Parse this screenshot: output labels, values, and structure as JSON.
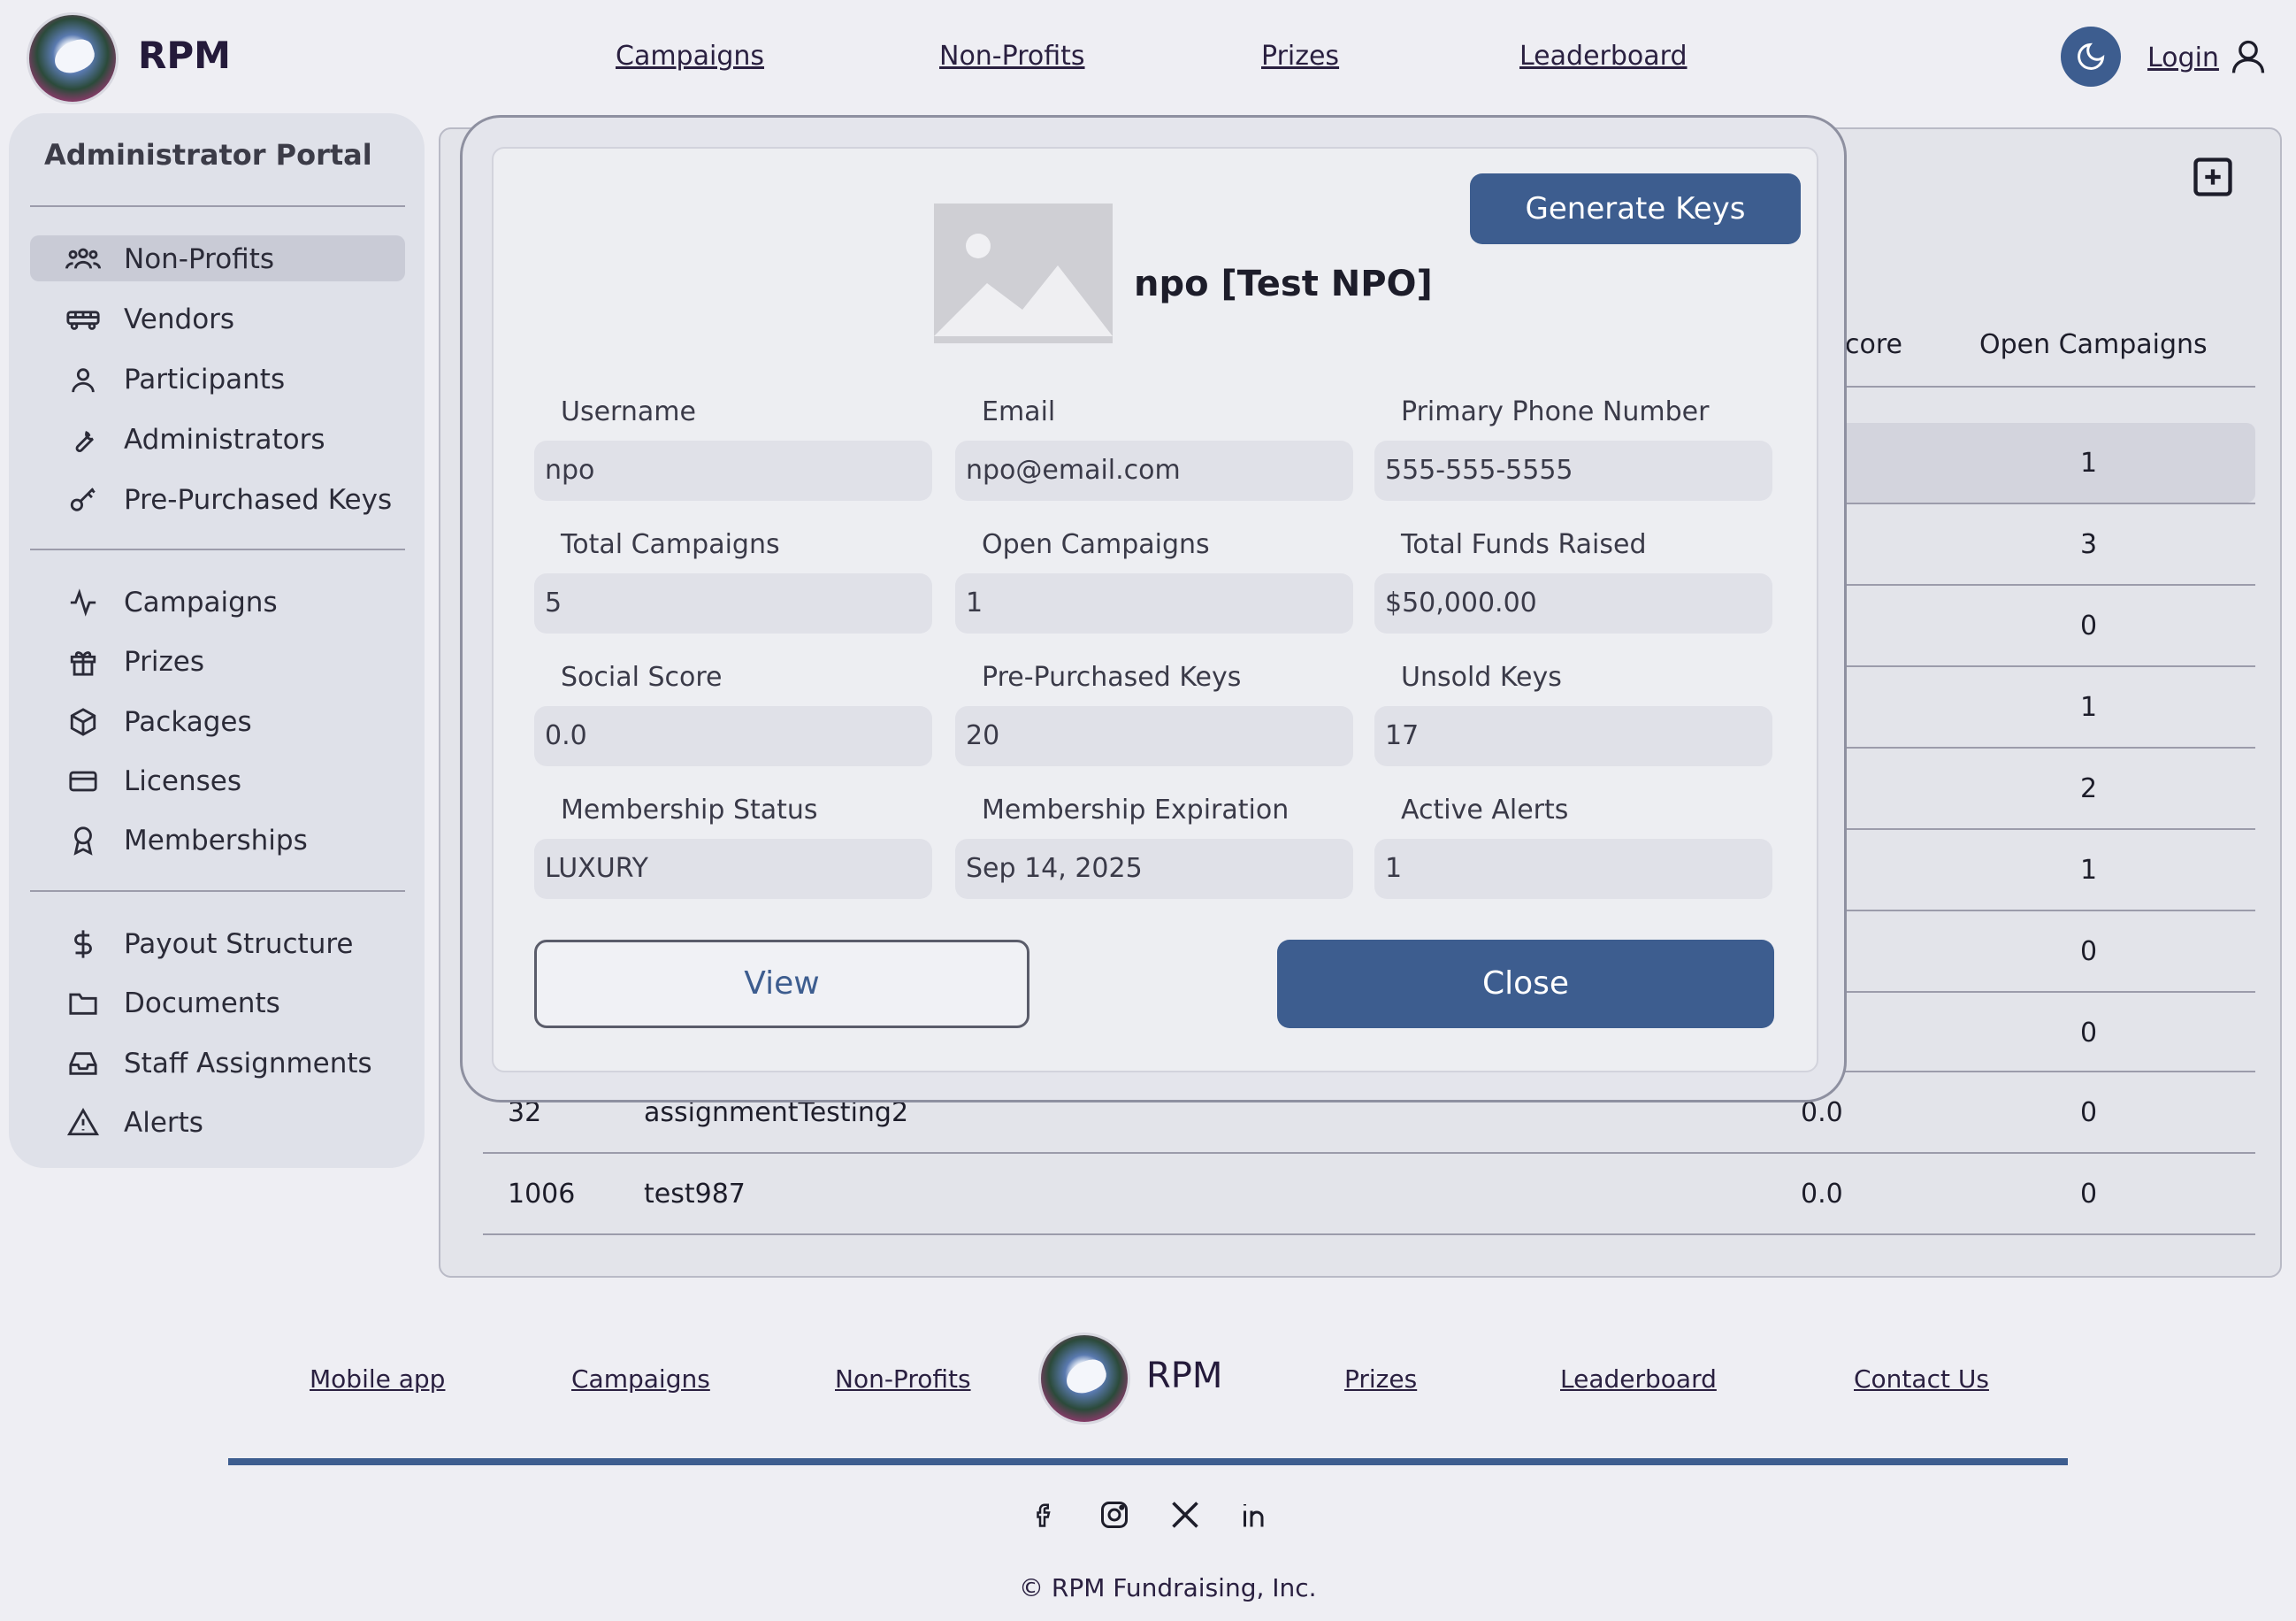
{
  "header": {
    "brand": "RPM",
    "nav": [
      "Campaigns",
      "Non-Profits",
      "Prizes",
      "Leaderboard"
    ],
    "login": "Login"
  },
  "sidebar": {
    "title": "Administrator Portal",
    "items": [
      {
        "label": "Non-Profits",
        "icon": "users-icon"
      },
      {
        "label": "Vendors",
        "icon": "truck-icon"
      },
      {
        "label": "Participants",
        "icon": "user-icon"
      },
      {
        "label": "Administrators",
        "icon": "wrench-icon"
      },
      {
        "label": "Pre-Purchased Keys",
        "icon": "key-icon"
      },
      {
        "label": "Campaigns",
        "icon": "activity-icon"
      },
      {
        "label": "Prizes",
        "icon": "gift-icon"
      },
      {
        "label": "Packages",
        "icon": "package-icon"
      },
      {
        "label": "Licenses",
        "icon": "credit-card-icon"
      },
      {
        "label": "Memberships",
        "icon": "award-icon"
      },
      {
        "label": "Payout Structure",
        "icon": "dollar-icon"
      },
      {
        "label": "Documents",
        "icon": "folder-icon"
      },
      {
        "label": "Staff Assignments",
        "icon": "inbox-icon"
      },
      {
        "label": "Alerts",
        "icon": "alert-triangle-icon"
      }
    ]
  },
  "table": {
    "headers": {
      "score_partial": "core",
      "open_campaigns": "Open Campaigns"
    },
    "open_campaigns_visible": [
      "1",
      "3",
      "0",
      "1",
      "2",
      "1",
      "0",
      "0"
    ],
    "rows": [
      {
        "id": "32",
        "name": "assignmentTesting2",
        "score": "0.0",
        "open": "0"
      },
      {
        "id": "1006",
        "name": "test987",
        "score": "0.0",
        "open": "0"
      }
    ]
  },
  "modal": {
    "generate_keys": "Generate Keys",
    "title": "npo [Test NPO]",
    "fields": [
      {
        "label": "Username",
        "value": "npo"
      },
      {
        "label": "Email",
        "value": "npo@email.com"
      },
      {
        "label": "Primary Phone Number",
        "value": "555-555-5555"
      },
      {
        "label": "Total Campaigns",
        "value": "5"
      },
      {
        "label": "Open Campaigns",
        "value": "1"
      },
      {
        "label": "Total Funds Raised",
        "value": "$50,000.00"
      },
      {
        "label": "Social Score",
        "value": "0.0"
      },
      {
        "label": "Pre-Purchased Keys",
        "value": "20"
      },
      {
        "label": "Unsold Keys",
        "value": "17"
      },
      {
        "label": "Membership Status",
        "value": "LUXURY"
      },
      {
        "label": "Membership Expiration",
        "value": "Sep 14, 2025"
      },
      {
        "label": "Active Alerts",
        "value": "1"
      }
    ],
    "view": "View",
    "close": "Close"
  },
  "footer": {
    "links": [
      "Mobile app",
      "Campaigns",
      "Non-Profits",
      "Prizes",
      "Leaderboard",
      "Contact Us"
    ],
    "brand": "RPM",
    "social": [
      "facebook-icon",
      "instagram-icon",
      "x-icon",
      "linkedin-icon"
    ],
    "copyright": "© RPM Fundraising, Inc."
  },
  "colors": {
    "accent": "#3d5d8f",
    "background": "#eeeef3",
    "panel": "#e3e4ea"
  }
}
